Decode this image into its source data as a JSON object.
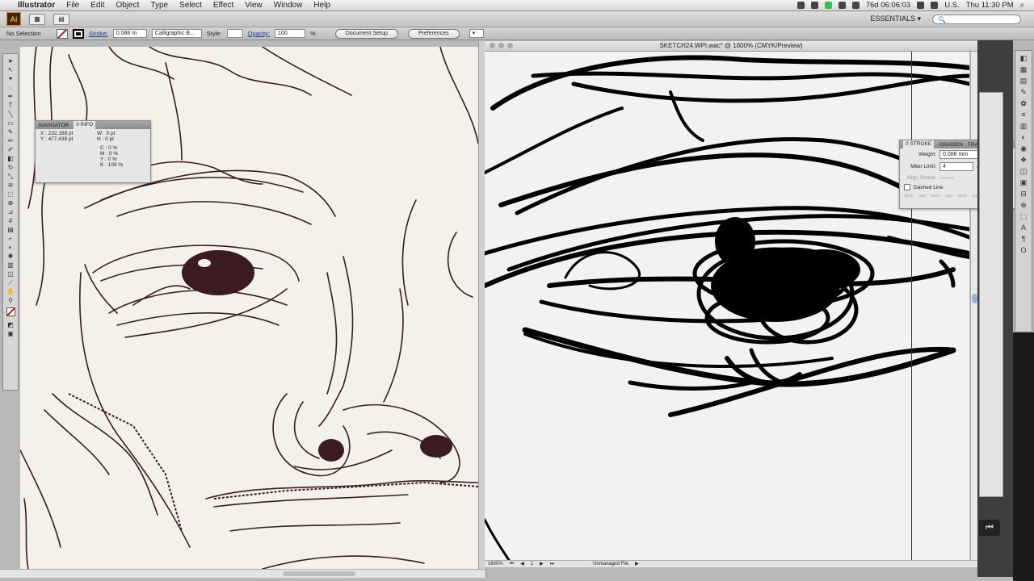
{
  "menubar": {
    "apple": "",
    "app_name": "Illustrator",
    "items": [
      "File",
      "Edit",
      "Object",
      "Type",
      "Select",
      "Effect",
      "View",
      "Window",
      "Help"
    ],
    "status": "76d 06:06:03",
    "locale": "U.S.",
    "clock": "Thu 11:30 PM"
  },
  "appbar": {
    "logo": "Ai",
    "workspace": "ESSENTIALS ▾",
    "search_placeholder": "🔍"
  },
  "control": {
    "selection": "No Selection",
    "stroke_label": "Stroke:",
    "stroke_weight": "0.088 m",
    "brush": "Calligraphic B...",
    "style_label": "Style:",
    "opacity_label": "Opacity:",
    "opacity_value": "100",
    "percent": "%",
    "document_setup": "Document Setup",
    "preferences": "Preferences"
  },
  "document": {
    "title": "SKETCH24.WPI.wac* @ 1600% (CMYK/Preview)",
    "zoom": "1600%",
    "page": "1",
    "status": "Unmanaged File"
  },
  "navigator_panel": {
    "tabs": [
      "NAVIGATOR",
      "0 INFO"
    ],
    "x": "X : 232.188 pt",
    "y": "Y : 477.438 pt",
    "w": "W : 0 pt",
    "h": "H : 0 pt",
    "c": "C : 0 %",
    "m": "M : 0 %",
    "yy": "Y : 0 %",
    "k": "K : 100 %"
  },
  "stroke_panel": {
    "tabs": [
      "0 STROKE",
      "GRADIEN",
      "TRANSP"
    ],
    "weight_label": "Weight:",
    "weight_value": "0.088 mm",
    "miter_label": "Miter Limit:",
    "miter_value": "4",
    "align_label": "Align Stroke:",
    "dashed_label": "Dashed Line",
    "dash_cells": [
      "dash",
      "gap",
      "dash",
      "gap",
      "dash",
      "gap"
    ]
  },
  "colors": {
    "ink_scan": "#3a1b22",
    "ink_vector": "#000000",
    "paper": "#f4f1ea"
  }
}
